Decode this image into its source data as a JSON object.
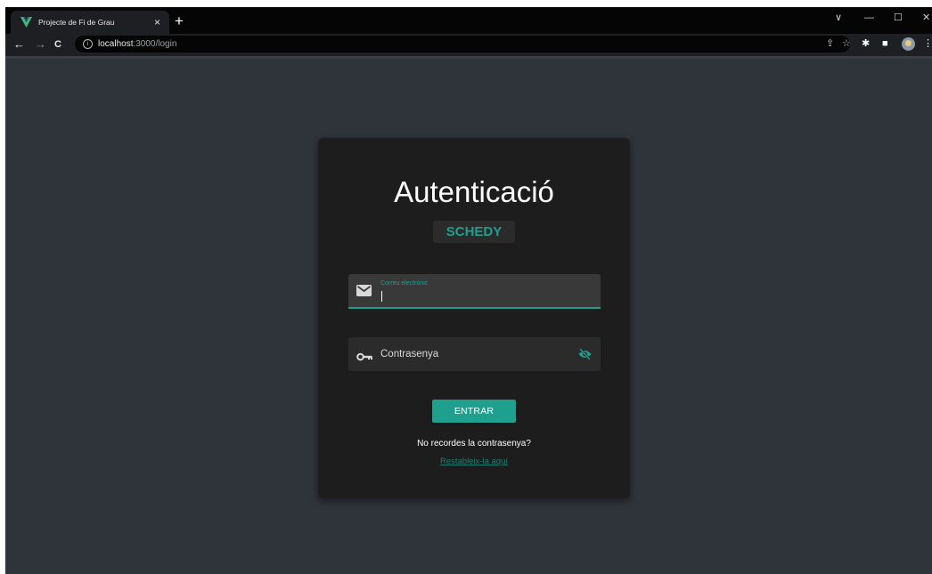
{
  "browser": {
    "tab": {
      "title": "Projecte de Fi de Grau",
      "favicon": "vue-logo-icon",
      "close": "×"
    },
    "new_tab": "+",
    "address": {
      "host": "localhost",
      "rest": ":3000/login"
    },
    "nav_icons": {
      "back": "←",
      "forward": "→",
      "reload": "C"
    },
    "window_controls": {
      "dropdown": "∨",
      "minimize": "—",
      "maximize": "☐",
      "close": "✕"
    },
    "toolbar_icons": {
      "share": "⇪",
      "star": "☆",
      "extensions": "✱",
      "sidepanel": "■",
      "menu": "⋮"
    }
  },
  "card": {
    "title": "Autenticació",
    "brand": "SCHEDY",
    "email": {
      "label": "Correu electrònic",
      "value": "",
      "icon": "mail-icon"
    },
    "password": {
      "placeholder": "Contrasenya",
      "icon": "key-icon",
      "toggle_icon": "eye-off-icon"
    },
    "submit_label": "ENTRAR",
    "forgot_text": "No recordes la contrasenya?",
    "reset_link": "Restableix-la aquí"
  },
  "colors": {
    "accent": "#1f9f8e",
    "page_bg": "#2f333a",
    "card_bg": "#1d1d1d"
  }
}
